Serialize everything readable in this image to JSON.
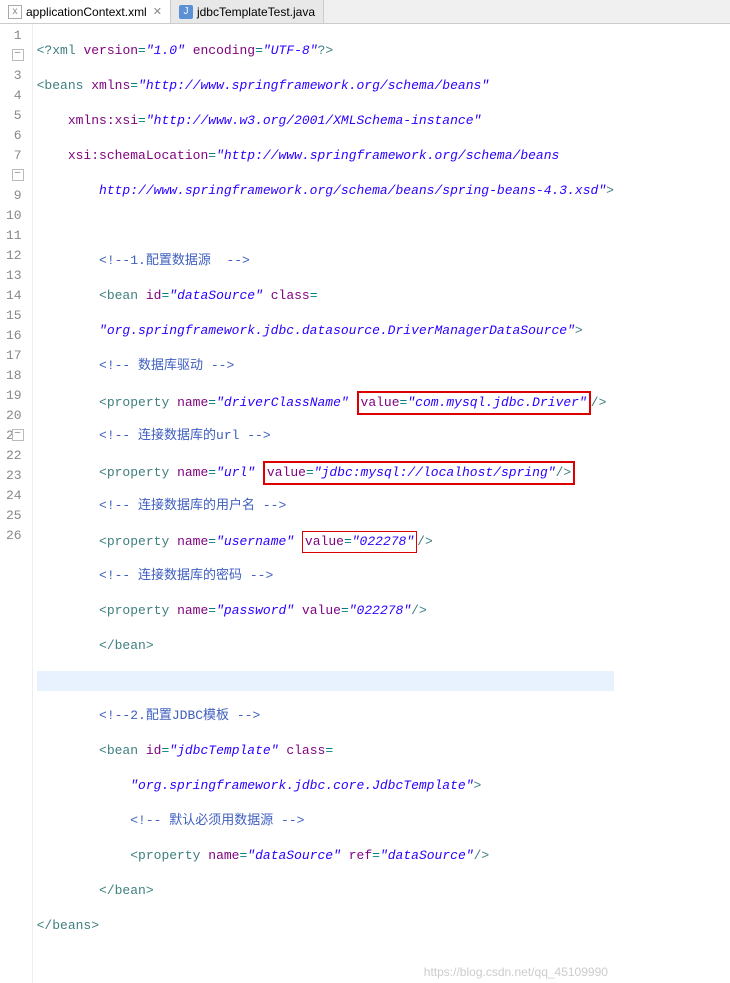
{
  "tabs": [
    {
      "label": "applicationContext.xml",
      "active": true,
      "icon": "x"
    },
    {
      "label": "jdbcTemplateTest.java",
      "active": false,
      "icon": "J"
    }
  ],
  "lines": {
    "l1": {
      "pi1": "<?xml",
      "attr_ver": "version",
      "val_ver": "\"1.0\"",
      "attr_enc": "encoding",
      "val_enc": "\"UTF-8\"",
      "pi2": "?>"
    },
    "l2": {
      "open": "<beans",
      "attr": "xmlns",
      "val": "\"http://www.springframework.org/schema/beans\""
    },
    "l3": {
      "attr": "xmlns:xsi",
      "val": "\"http://www.w3.org/2001/XMLSchema-instance\""
    },
    "l4": {
      "attr": "xsi:schemaLocation",
      "val": "\"http://www.springframework.org/schema/beans"
    },
    "l5": {
      "val": "http://www.springframework.org/schema/beans/spring-beans-4.3.xsd\"",
      "close": ">"
    },
    "l7": {
      "cmt": "<!--1.配置数据源  -->"
    },
    "l8": {
      "open": "<bean",
      "attr_id": "id",
      "val_id": "\"dataSource\"",
      "attr_cls": "class",
      "eq": "="
    },
    "l9": {
      "val": "\"org.springframework.jdbc.datasource.DriverManagerDataSource\"",
      "close": ">"
    },
    "l10": {
      "cmt": "<!-- 数据库驱动 -->"
    },
    "l11": {
      "open": "<property",
      "attr_name": "name",
      "val_name": "\"driverClassName\"",
      "attr_val": "value",
      "val_val": "\"com.mysql.jdbc.Driver\"",
      "close": "/>"
    },
    "l12": {
      "cmt": "<!-- 连接数据库的url -->"
    },
    "l13": {
      "open": "<property",
      "attr_name": "name",
      "val_name": "\"url\"",
      "attr_val": "value",
      "val_val": "\"jdbc:mysql://localhost/spring\"",
      "close": "/>"
    },
    "l14": {
      "cmt": "<!-- 连接数据库的用户名 -->"
    },
    "l15": {
      "open": "<property",
      "attr_name": "name",
      "val_name": "\"username\"",
      "attr_val": "value",
      "val_val": "\"022278\"",
      "close": "/>"
    },
    "l16": {
      "cmt": "<!-- 连接数据库的密码 -->"
    },
    "l17": {
      "open": "<property",
      "attr_name": "name",
      "val_name": "\"password\"",
      "attr_val": "value",
      "val_val": "\"022278\"",
      "close": "/>"
    },
    "l18": {
      "close": "</bean>"
    },
    "l20": {
      "cmt": "<!--2.配置JDBC模板 -->"
    },
    "l21": {
      "open": "<bean",
      "attr_id": "id",
      "val_id": "\"jdbcTemplate\"",
      "attr_cls": "class",
      "eq": "="
    },
    "l22": {
      "val": "\"org.springframework.jdbc.core.JdbcTemplate\"",
      "close": ">"
    },
    "l23": {
      "cmt": "<!-- 默认必须用数据源 -->"
    },
    "l24": {
      "open": "<property",
      "attr_name": "name",
      "val_name": "\"dataSource\"",
      "attr_ref": "ref",
      "val_ref": "\"dataSource\"",
      "close": "/>"
    },
    "l25": {
      "close": "</bean>"
    },
    "l26": {
      "close": "</beans>"
    }
  },
  "watermark": "https://blog.csdn.net/qq_45109990"
}
